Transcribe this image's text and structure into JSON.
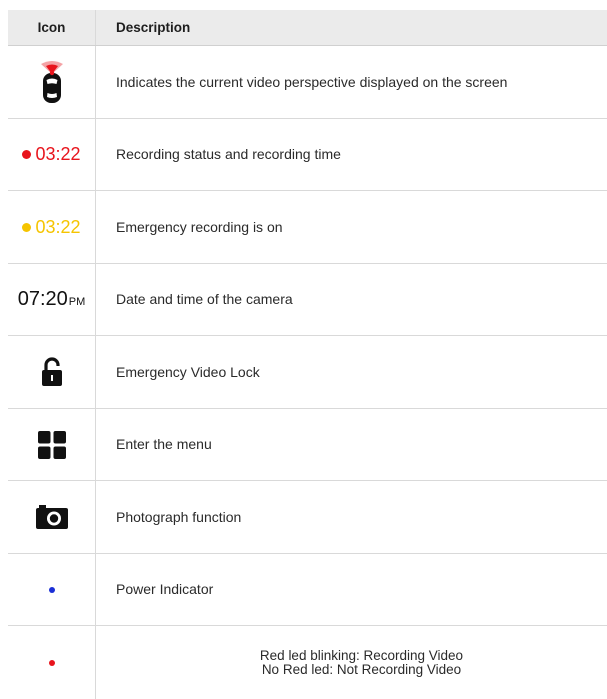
{
  "header": {
    "icon_col": "Icon",
    "desc_col": "Description"
  },
  "rows": [
    {
      "icon": "car-perspective-icon",
      "description": "Indicates the current video perspective displayed on the screen"
    },
    {
      "icon": "red-dot",
      "icon_text": "03:22",
      "description": "Recording status and recording time"
    },
    {
      "icon": "yellow-dot",
      "icon_text": "03:22",
      "description": "Emergency recording is on"
    },
    {
      "icon": "clock",
      "icon_text": "07:20",
      "icon_suffix": "PM",
      "description": "Date and time of the camera"
    },
    {
      "icon": "lock-icon",
      "description": "Emergency Video Lock"
    },
    {
      "icon": "grid-menu-icon",
      "description": "Enter the menu"
    },
    {
      "icon": "camera-icon",
      "description": "Photograph function"
    },
    {
      "icon": "blue-dot",
      "description": "Power Indicator"
    },
    {
      "icon": "red-led-dot",
      "description_lines": [
        "Red led blinking: Recording Video",
        "No Red led: Not Recording Video"
      ]
    }
  ],
  "colors": {
    "recording_red": "#e8141c",
    "emergency_yellow": "#f5c400",
    "power_blue": "#1a2fd6",
    "led_red": "#e8141c",
    "header_bg": "#ebebeb"
  }
}
